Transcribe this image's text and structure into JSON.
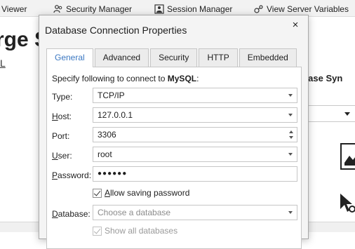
{
  "app": {
    "toolbar": {
      "viewer_label": "Viewer",
      "security_manager_label": "Security Manager",
      "session_manager_label": "Session Manager",
      "view_server_variables_label": "View Server Variables"
    },
    "background_title": "rge S",
    "background_subtitle": "L",
    "background_right_label": "abase Syn"
  },
  "dialog": {
    "title": "Database Connection Properties",
    "close_glyph": "×",
    "tabs": [
      {
        "label": "General"
      },
      {
        "label": "Advanced"
      },
      {
        "label": "Security"
      },
      {
        "label": "HTTP"
      },
      {
        "label": "Embedded"
      }
    ],
    "active_tab": "General",
    "intro_prefix": "Specify following to connect to ",
    "intro_db": "MySQL",
    "intro_suffix": ":",
    "fields": {
      "type": {
        "label_accel": "",
        "label_rest": "Type:",
        "value": "TCP/IP"
      },
      "host": {
        "label_accel": "H",
        "label_rest": "ost:",
        "value": "127.0.0.1"
      },
      "port": {
        "label_accel": "",
        "label_rest": "Port:",
        "value": "3306"
      },
      "user": {
        "label_accel": "U",
        "label_rest": "ser:",
        "value": "root"
      },
      "password": {
        "label_accel": "P",
        "label_rest": "assword:",
        "value": "●●●●●●"
      },
      "database": {
        "label_accel": "D",
        "label_rest": "atabase:",
        "placeholder": "Choose a database"
      }
    },
    "allow_saving_password": {
      "accel": "A",
      "rest": "llow saving password",
      "checked": true
    },
    "show_all_databases": {
      "label": "Show all databases",
      "checked": true,
      "enabled": false
    }
  }
}
